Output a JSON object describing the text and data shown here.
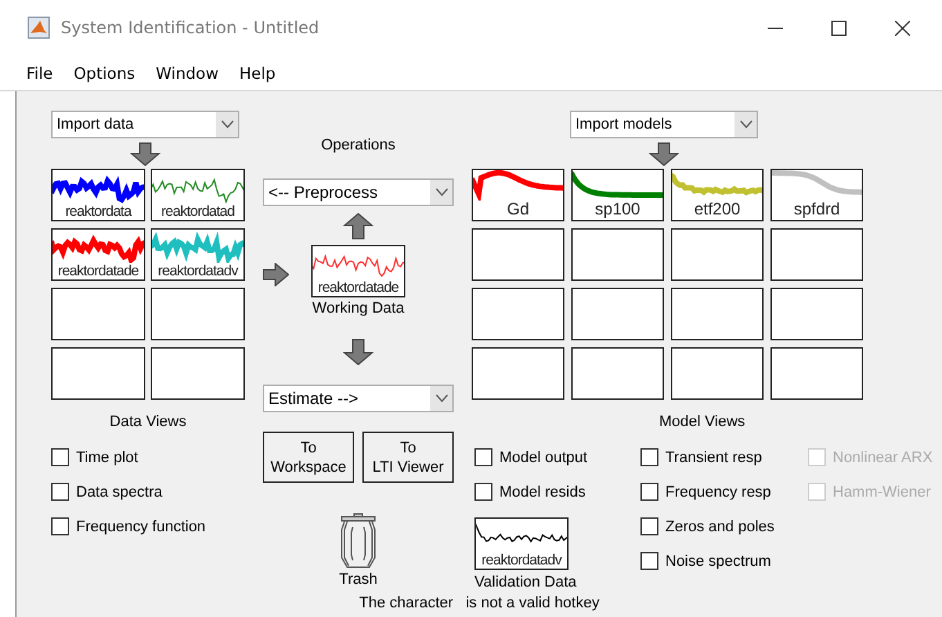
{
  "window": {
    "title": "System Identification - Untitled"
  },
  "menu": [
    "File",
    "Options",
    "Window",
    "Help"
  ],
  "data_panel": {
    "import": "Import data",
    "tiles": [
      {
        "kind": "data",
        "label": "reaktordata",
        "color": "#0000ff"
      },
      {
        "kind": "data",
        "label": "reaktordatad",
        "color": "#228b22"
      },
      {
        "kind": "data",
        "label": "reaktordatade",
        "color": "#ff0000"
      },
      {
        "kind": "data",
        "label": "reaktordatadv",
        "color": "#1fbfbf"
      },
      {
        "kind": "empty"
      },
      {
        "kind": "empty"
      },
      {
        "kind": "empty"
      },
      {
        "kind": "empty"
      }
    ],
    "views_title": "Data Views",
    "views": [
      {
        "label": "Time plot",
        "checked": false,
        "disabled": false
      },
      {
        "label": "Data spectra",
        "checked": false,
        "disabled": false
      },
      {
        "label": "Frequency function",
        "checked": false,
        "disabled": false
      }
    ]
  },
  "operations": {
    "title": "Operations",
    "preprocess": "<-- Preprocess",
    "working_data": {
      "label": "reaktordatade",
      "color": "#ff3030"
    },
    "working_title": "Working Data",
    "estimate": "Estimate -->",
    "buttons": [
      {
        "line1": "To",
        "line2": "Workspace"
      },
      {
        "line1": "To",
        "line2": "LTI Viewer"
      }
    ],
    "trash": "Trash"
  },
  "model_panel": {
    "import": "Import models",
    "tiles": [
      {
        "kind": "model",
        "label": "Gd",
        "color": "#ff0000"
      },
      {
        "kind": "model",
        "label": "sp100",
        "color": "#008000"
      },
      {
        "kind": "model",
        "label": "etf200",
        "color": "#c0c030"
      },
      {
        "kind": "model",
        "label": "spfdrd",
        "color": "#c0c0c0"
      },
      {
        "kind": "empty"
      },
      {
        "kind": "empty"
      },
      {
        "kind": "empty"
      },
      {
        "kind": "empty"
      },
      {
        "kind": "empty"
      },
      {
        "kind": "empty"
      },
      {
        "kind": "empty"
      },
      {
        "kind": "empty"
      },
      {
        "kind": "empty"
      },
      {
        "kind": "empty"
      },
      {
        "kind": "empty"
      },
      {
        "kind": "empty"
      }
    ],
    "views_title": "Model Views",
    "view_columns": [
      [
        {
          "label": "Model output",
          "checked": false,
          "disabled": false
        },
        {
          "label": "Model resids",
          "checked": false,
          "disabled": false
        }
      ],
      [
        {
          "label": "Transient resp",
          "checked": false,
          "disabled": false
        },
        {
          "label": "Frequency resp",
          "checked": false,
          "disabled": false
        },
        {
          "label": "Zeros and poles",
          "checked": false,
          "disabled": false
        },
        {
          "label": "Noise spectrum",
          "checked": false,
          "disabled": false
        }
      ],
      [
        {
          "label": "Nonlinear ARX",
          "checked": false,
          "disabled": true
        },
        {
          "label": "Hamm-Wiener",
          "checked": false,
          "disabled": true
        }
      ]
    ],
    "validation_data": {
      "label": "reaktordatadv",
      "color": "#000000"
    },
    "validation_title": "Validation Data"
  },
  "status_bar": {
    "before": "The character",
    "after": "is not a valid hotkey"
  }
}
